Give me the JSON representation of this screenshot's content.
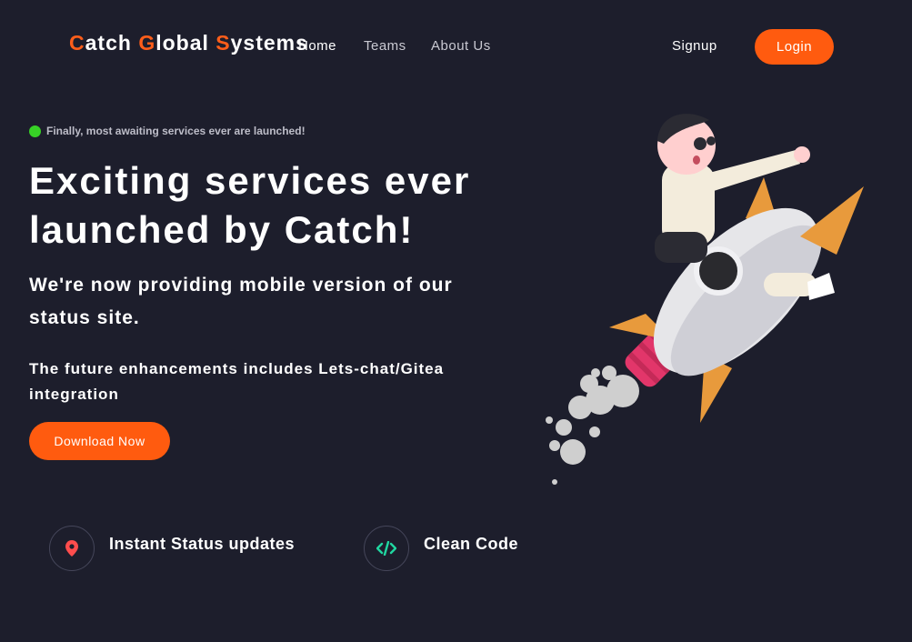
{
  "nav": {
    "brand": {
      "c": "C",
      "atch": "atch ",
      "g": "G",
      "lobal": "lobal ",
      "s": "S",
      "ystems": "ystems"
    },
    "links": [
      {
        "label": "Home",
        "active": true
      },
      {
        "label": "Teams",
        "active": false
      },
      {
        "label": "About Us",
        "active": false
      }
    ],
    "signup_label": "Signup",
    "login_label": "Login"
  },
  "hero": {
    "badge_text": "Finally, most awaiting services ever are launched!",
    "title": "Exciting services ever launched by Catch!",
    "subtitle": "We're now providing mobile version of our status site.",
    "note": "The future enhancements includes Lets-chat/Gitea integration",
    "download_label": "Download Now"
  },
  "features": [
    {
      "label": "Instant Status updates",
      "icon": "location-pin-icon"
    },
    {
      "label": "Clean Code",
      "icon": "code-icon"
    }
  ],
  "colors": {
    "background": "#1d1e2c",
    "accent": "#ff5b0f",
    "badge_dot": "#37d126",
    "pin_icon": "#ff4d4d",
    "code_icon": "#20d6a0"
  }
}
